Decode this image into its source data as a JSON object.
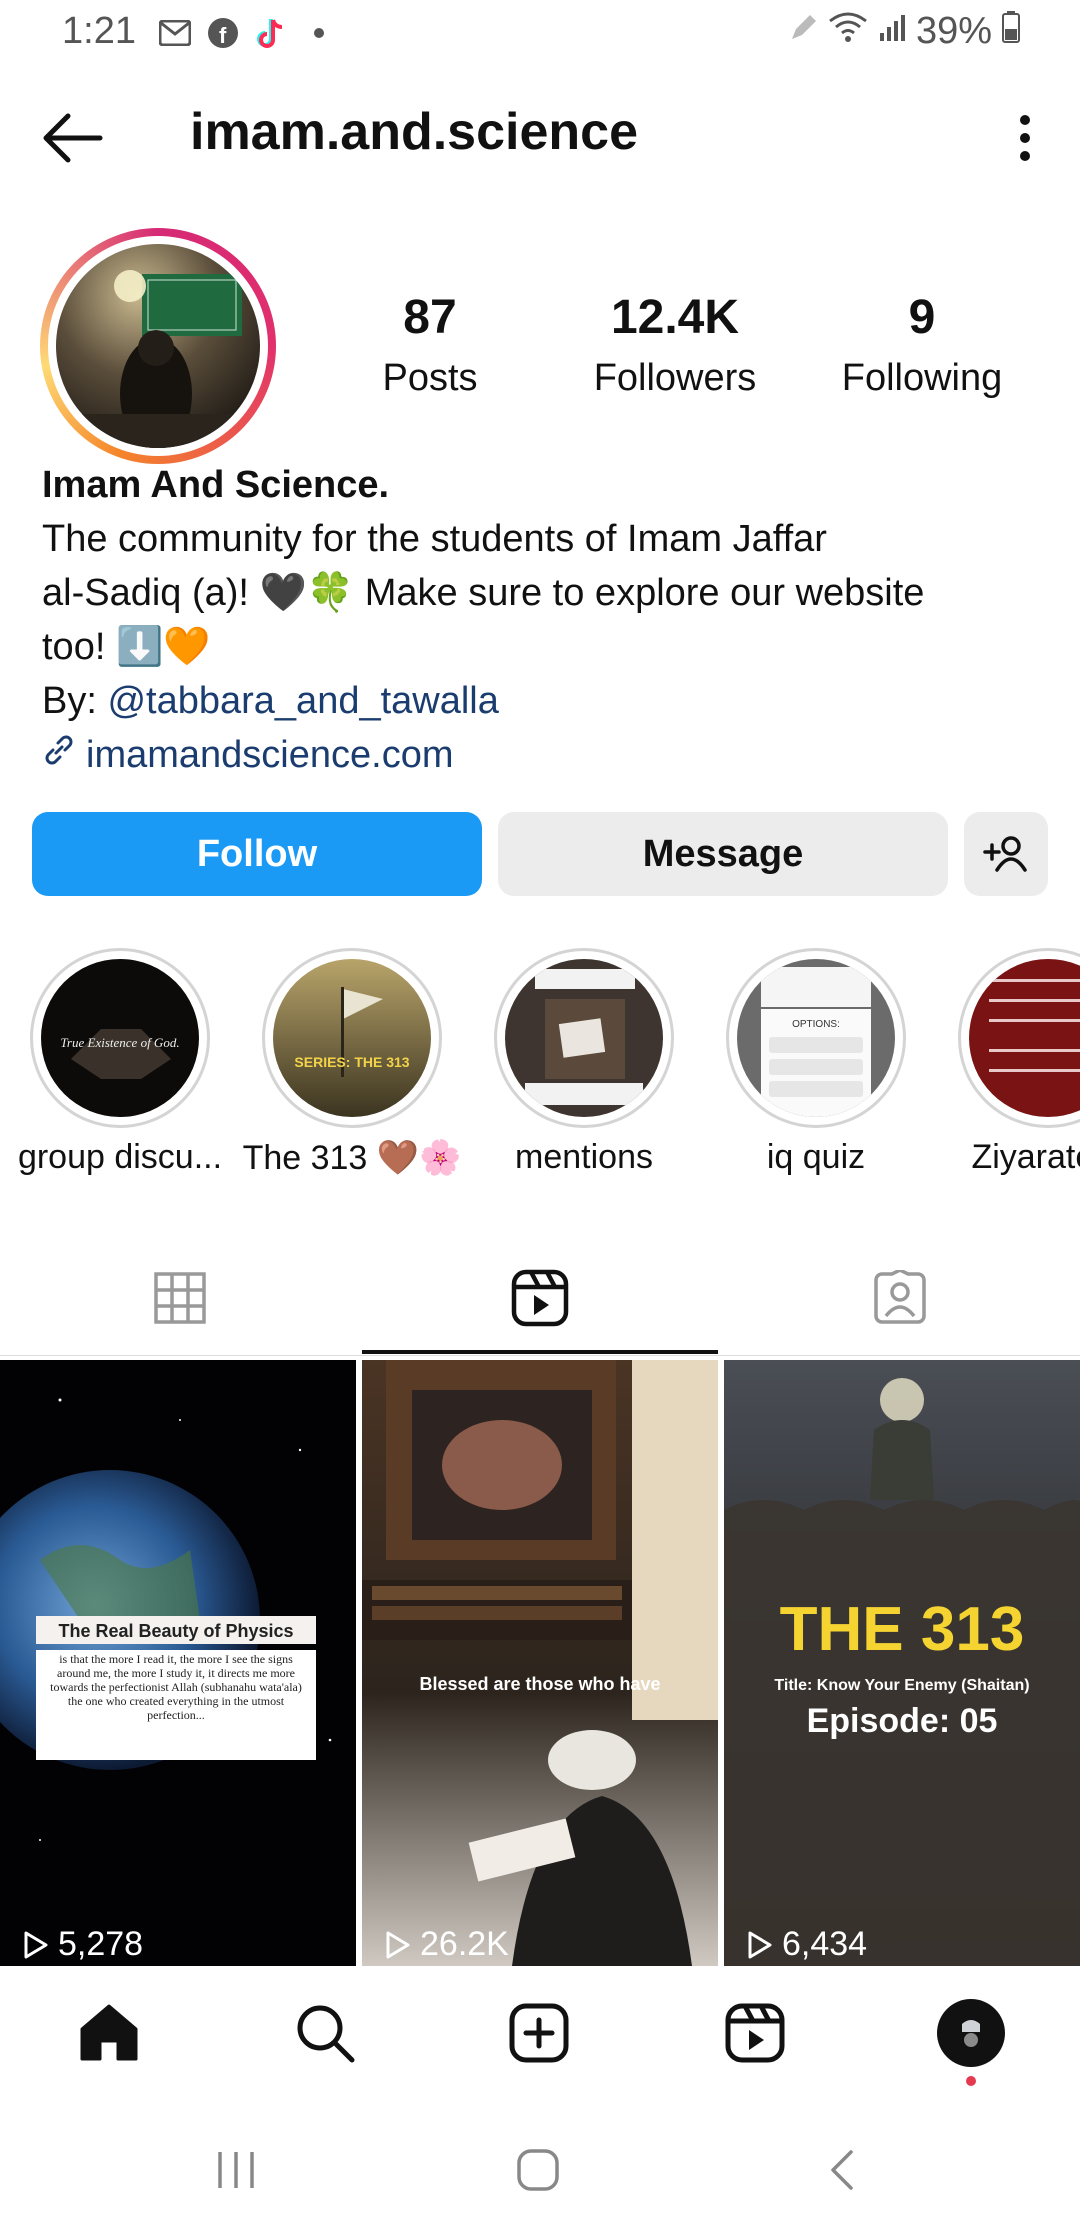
{
  "status_bar": {
    "time": "1:21",
    "battery": "39%"
  },
  "header": {
    "username": "imam.and.science"
  },
  "profile": {
    "stats": [
      {
        "value": "87",
        "label": "Posts"
      },
      {
        "value": "12.4K",
        "label": "Followers"
      },
      {
        "value": "9",
        "label": "Following"
      }
    ],
    "name": "Imam And Science.",
    "bio_line1": "The community for the students of Imam Jaffar",
    "bio_line2": "al-Sadiq (a)! 🖤🍀 Make sure to explore our website",
    "bio_line3": "too! ⬇️🧡",
    "by_prefix": "By: ",
    "by_handle": "@tabbara_and_tawalla",
    "website": "imamandscience.com"
  },
  "actions": {
    "follow": "Follow",
    "message": "Message"
  },
  "highlights": [
    {
      "label": "group discu..."
    },
    {
      "label": "The 313 🤎🌸"
    },
    {
      "label": "mentions"
    },
    {
      "label": "iq quiz"
    },
    {
      "label": "Ziyarate A"
    }
  ],
  "highlight_art": {
    "h1_text": "True Existence of God.",
    "h2_text": "SERIES: THE 313",
    "h4_text": "OPTIONS:"
  },
  "posts": [
    {
      "views": "5,278",
      "caption_title": "The Real Beauty of Physics",
      "caption_body": "is that the more I read it, the more I see the signs around me, the more I study it, it directs me more towards the perfectionist Allah (subhanahu wata'ala) the one who created everything in the utmost perfection..."
    },
    {
      "views": "26.2K",
      "caption_title": "Blessed are those who have"
    },
    {
      "views": "6,434",
      "caption_title": "THE 313",
      "caption_sub": "Title: Know Your Enemy (Shaitan)",
      "caption_episode": "Episode: 05"
    }
  ],
  "colors": {
    "follow_blue": "#1a9af5",
    "link_blue": "#1a3c6e",
    "notification_dot": "#e53950"
  }
}
